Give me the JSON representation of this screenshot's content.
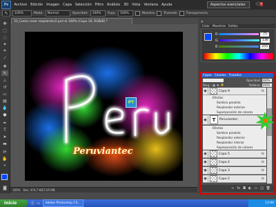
{
  "menubar": {
    "logo": "Ps",
    "items": [
      "Archivo",
      "Edición",
      "Imagen",
      "Capa",
      "Selección",
      "Filtro",
      "Análisis",
      "3D",
      "Vista",
      "Ventana",
      "Ayuda"
    ],
    "workspace": "Aspectos esenciales",
    "window_buttons": [
      "-",
      "□",
      "×"
    ]
  },
  "options": {
    "size": "100%",
    "mode_label": "Modo:",
    "mode": "Normal",
    "opacity_label": "Opacidad:",
    "opacity": "100%",
    "flow_label": "Flujo:",
    "flow": "100%",
    "muestra_label": "Muestra",
    "tramado_label": "Tramado",
    "transparencia_label": "Transparencia"
  },
  "document": {
    "tab_title": "33_Como crear resplandor2.psd al 100% (Capa 16, RGB/8) *",
    "status_zoom": "100%",
    "status_doc": "Doc: 474,7 KB/7,05 MB"
  },
  "artwork": {
    "title": "Peru",
    "subtitle": "Peruviantec",
    "logo_text": "PT"
  },
  "color_panel": {
    "tabs": [
      "Color",
      "Muestras",
      "Estilos"
    ],
    "rows": [
      {
        "label": "R",
        "value": "75"
      },
      {
        "label": "G",
        "value": "136"
      },
      {
        "label": "B",
        "value": "255"
      }
    ]
  },
  "layers_panel": {
    "tabs": [
      "Capas",
      "Canales",
      "Trazados"
    ],
    "opacity_label": "Opacidad:",
    "opacity": "100%",
    "fill_label": "Relleno:",
    "fill": "100%",
    "lock_label": "Bloq.:",
    "layers": [
      {
        "name": "Capa 9",
        "has_fx": true
      },
      {
        "name": "Efectos",
        "type": "effects"
      },
      {
        "name": "Sombra paralela",
        "type": "effect"
      },
      {
        "name": "Resplandor exterior",
        "type": "effect"
      },
      {
        "name": "Superposición de colores",
        "type": "effect"
      },
      {
        "name": "Peruviantec",
        "has_fx": true,
        "text_layer": true
      },
      {
        "name": "Efectos",
        "type": "effects"
      },
      {
        "name": "Sombra paralela",
        "type": "effect"
      },
      {
        "name": "Resplandor exterior",
        "type": "effect"
      },
      {
        "name": "Resplandor interior",
        "type": "effect"
      },
      {
        "name": "Superposición de colores",
        "type": "effect"
      },
      {
        "name": "Capa 5",
        "has_fx": true
      },
      {
        "name": "Capa 4",
        "has_fx": true
      },
      {
        "name": "Capa 3",
        "has_fx": true
      },
      {
        "name": "Capa 2",
        "has_fx": true
      }
    ]
  },
  "taskbar": {
    "start_label": "Inicio",
    "task": "Adobe Photoshop CS...",
    "clock": "13:00"
  },
  "colors": {
    "highlight_border": "#e00000",
    "starburst": "#33cc33",
    "swatch_fg": "#0047ff",
    "swatch_bg": "#ffffff"
  }
}
